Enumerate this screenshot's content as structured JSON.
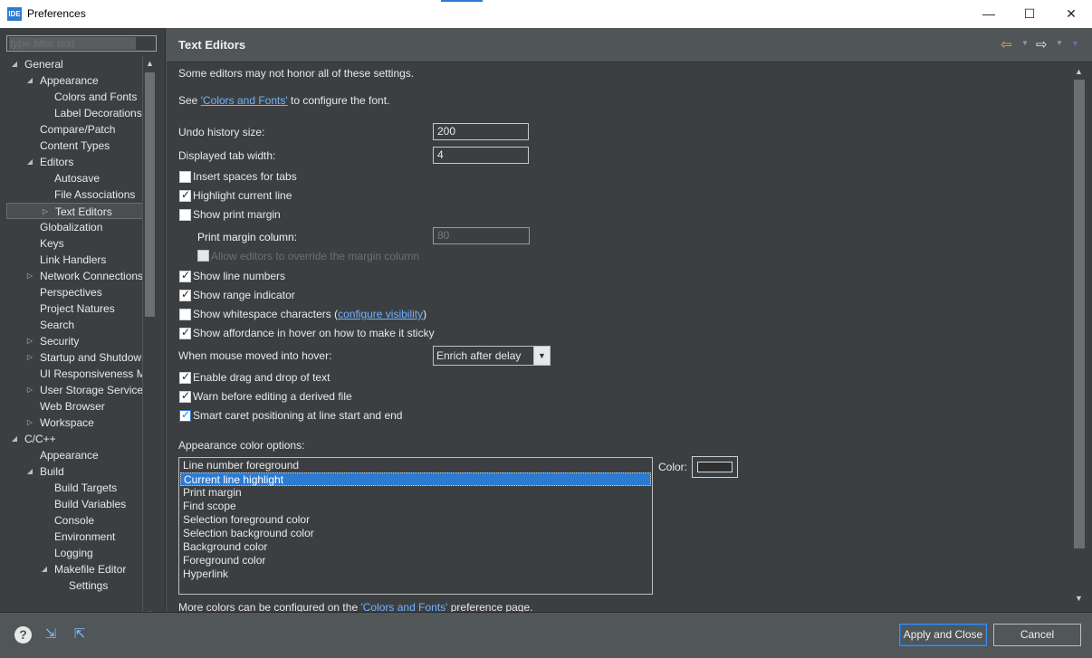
{
  "window": {
    "title": "Preferences",
    "app_icon": "IDE",
    "minimize": "—",
    "maximize": "☐",
    "close": "✕"
  },
  "filter": {
    "placeholder": "type filter text"
  },
  "tree": [
    {
      "label": "General",
      "level": 0,
      "twisty": "expanded"
    },
    {
      "label": "Appearance",
      "level": 1,
      "twisty": "expanded"
    },
    {
      "label": "Colors and Fonts",
      "level": 2,
      "twisty": "none"
    },
    {
      "label": "Label Decorations",
      "level": 2,
      "twisty": "none"
    },
    {
      "label": "Compare/Patch",
      "level": 1,
      "twisty": "none"
    },
    {
      "label": "Content Types",
      "level": 1,
      "twisty": "none"
    },
    {
      "label": "Editors",
      "level": 1,
      "twisty": "expanded"
    },
    {
      "label": "Autosave",
      "level": 2,
      "twisty": "none"
    },
    {
      "label": "File Associations",
      "level": 2,
      "twisty": "none"
    },
    {
      "label": "Text Editors",
      "level": 2,
      "twisty": "collapsed",
      "selected": true
    },
    {
      "label": "Globalization",
      "level": 1,
      "twisty": "none"
    },
    {
      "label": "Keys",
      "level": 1,
      "twisty": "none"
    },
    {
      "label": "Link Handlers",
      "level": 1,
      "twisty": "none"
    },
    {
      "label": "Network Connections",
      "level": 1,
      "twisty": "collapsed"
    },
    {
      "label": "Perspectives",
      "level": 1,
      "twisty": "none"
    },
    {
      "label": "Project Natures",
      "level": 1,
      "twisty": "none"
    },
    {
      "label": "Search",
      "level": 1,
      "twisty": "none"
    },
    {
      "label": "Security",
      "level": 1,
      "twisty": "collapsed"
    },
    {
      "label": "Startup and Shutdown",
      "level": 1,
      "twisty": "collapsed"
    },
    {
      "label": "UI Responsiveness Monitoring",
      "level": 1,
      "twisty": "none"
    },
    {
      "label": "User Storage Service",
      "level": 1,
      "twisty": "collapsed"
    },
    {
      "label": "Web Browser",
      "level": 1,
      "twisty": "none"
    },
    {
      "label": "Workspace",
      "level": 1,
      "twisty": "collapsed"
    },
    {
      "label": "C/C++",
      "level": 0,
      "twisty": "expanded"
    },
    {
      "label": "Appearance",
      "level": 1,
      "twisty": "none"
    },
    {
      "label": "Build",
      "level": 1,
      "twisty": "expanded"
    },
    {
      "label": "Build Targets",
      "level": 2,
      "twisty": "none"
    },
    {
      "label": "Build Variables",
      "level": 2,
      "twisty": "none"
    },
    {
      "label": "Console",
      "level": 2,
      "twisty": "none"
    },
    {
      "label": "Environment",
      "level": 2,
      "twisty": "none"
    },
    {
      "label": "Logging",
      "level": 2,
      "twisty": "none"
    },
    {
      "label": "Makefile Editor",
      "level": 2,
      "twisty": "expanded"
    },
    {
      "label": "Settings",
      "level": 3,
      "twisty": "none"
    }
  ],
  "page": {
    "title": "Text Editors",
    "intro": "Some editors may not honor all of these settings.",
    "see_prefix": "See ",
    "see_link": "'Colors and Fonts'",
    "see_suffix": " to configure the font.",
    "undo_label": "Undo history size:",
    "undo_value": "200",
    "tab_label": "Displayed tab width:",
    "tab_value": "4",
    "insert_spaces": "Insert spaces for tabs",
    "highlight_line": "Highlight current line",
    "show_print_margin": "Show print margin",
    "print_margin_col_label": "Print margin column:",
    "print_margin_col_value": "80",
    "allow_override": "Allow editors to override the margin column",
    "show_line_numbers": "Show line numbers",
    "show_range": "Show range indicator",
    "show_whitespace": "Show whitespace characters",
    "ws_open": "(",
    "configure_visibility": "configure visibility",
    "ws_close": ")",
    "show_affordance": "Show affordance in hover on how to make it sticky",
    "hover_label": "When mouse moved into hover:",
    "hover_value": "Enrich after delay",
    "drag_drop": "Enable drag and drop of text",
    "warn_derived": "Warn before editing a derived file",
    "smart_caret": "Smart caret positioning at line start and end",
    "color_options_label": "Appearance color options:",
    "color_label": "Color:",
    "color_options": [
      "Line number foreground",
      "Current line highlight",
      "Print margin",
      "Find scope",
      "Selection foreground color",
      "Selection background color",
      "Background color",
      "Foreground color",
      "Hyperlink"
    ],
    "more_prefix": "More colors can be configured on the ",
    "more_link": "'Colors and Fonts'",
    "more_suffix": " preference page."
  },
  "buttons": {
    "apply_close": "Apply and Close",
    "cancel": "Cancel",
    "help": "?"
  },
  "colors": {
    "accent": "#2d7bd1",
    "link": "#6fb3ff",
    "swatch": "#2f2f2f"
  }
}
